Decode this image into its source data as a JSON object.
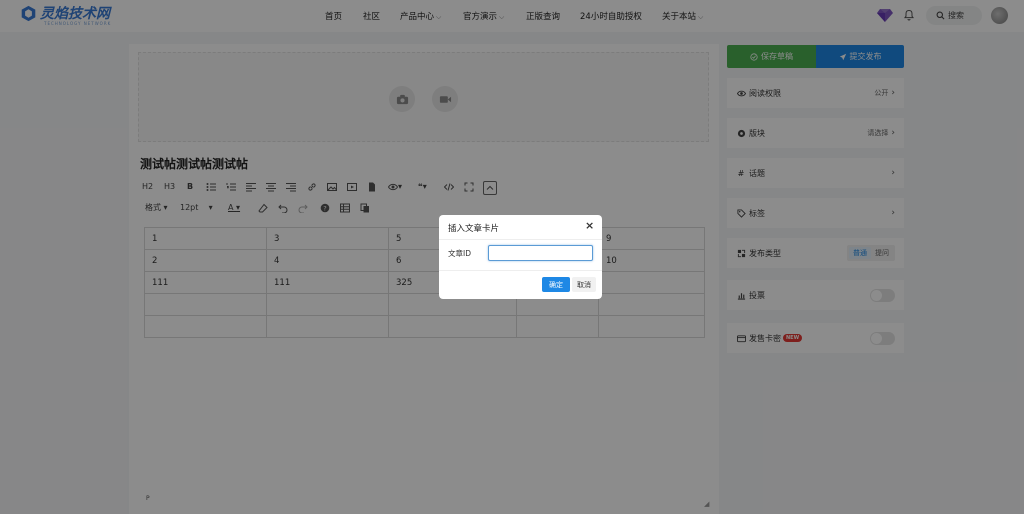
{
  "header": {
    "logo_text": "灵焰技术网",
    "logo_sub": "TECHNOLOGY NETWORK",
    "nav": [
      {
        "label": "首页"
      },
      {
        "label": "社区"
      },
      {
        "label": "产品中心"
      },
      {
        "label": "官方演示"
      },
      {
        "label": "正版查询"
      },
      {
        "label": "24小时自助授权"
      },
      {
        "label": "关于本站"
      }
    ],
    "search_label": "搜索",
    "icons": {
      "gem": "gem-icon",
      "bell": "bell-icon",
      "search": "search-icon"
    }
  },
  "editor": {
    "title": "测试帖测试帖测试帖",
    "toolbar1": [
      "H2",
      "H3",
      "B"
    ],
    "toolbar2": {
      "format": "格式",
      "font_size": "12pt",
      "font_color_label": "A"
    },
    "table": [
      [
        "1",
        "3",
        "5",
        "",
        "9"
      ],
      [
        "2",
        "4",
        "6",
        "",
        "10"
      ],
      [
        "111",
        "111",
        "325",
        "",
        ""
      ],
      [
        "",
        "",
        "",
        "",
        ""
      ],
      [
        "",
        "",
        "",
        "",
        ""
      ]
    ],
    "path_label": "P"
  },
  "sidebar": {
    "save_label": "保存草稿",
    "submit_label": "提交发布",
    "read_perm": {
      "label": "阅读权限",
      "value": "公开"
    },
    "board": {
      "label": "版块",
      "value": "请选择"
    },
    "topic": {
      "label": "话题"
    },
    "tags": {
      "label": "标签"
    },
    "post_type": {
      "label": "发布类型",
      "options": [
        "普通",
        "提问"
      ],
      "selected": "普通"
    },
    "vote": {
      "label": "投票",
      "on": false
    },
    "card": {
      "label": "发售卡密",
      "badge": "NEW",
      "on": false
    }
  },
  "modal": {
    "title": "插入文章卡片",
    "field_label": "文章ID",
    "field_value": "",
    "field_placeholder": "",
    "ok_label": "确定",
    "cancel_label": "取消"
  },
  "colors": {
    "accent": "#1e88e5",
    "save_green": "#4caf50",
    "badge_red": "#e53935"
  }
}
